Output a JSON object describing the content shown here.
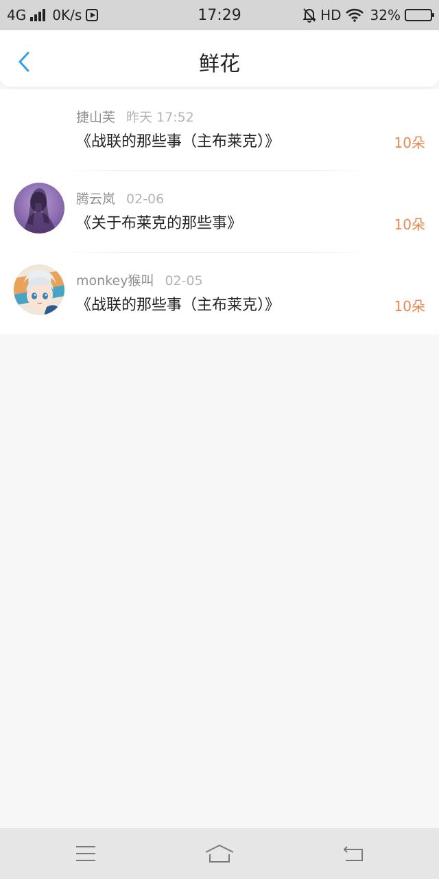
{
  "status_bar": {
    "network": "4G",
    "speed": "0K/s",
    "time": "17:29",
    "hd": "HD",
    "battery": "32%",
    "battery_level": 0.32,
    "icons": [
      "signal-icon",
      "media-play-icon",
      "mute-bell-icon",
      "wifi-icon",
      "battery-icon"
    ]
  },
  "header": {
    "title": "鲜花",
    "back_icon": "chevron-left-icon",
    "accent_color": "#2b9ff0"
  },
  "items": [
    {
      "user": "捷山芙",
      "date": "昨天 17:52",
      "title": "《战联的那些事（主布莱克）》",
      "count": "10朵",
      "avatar": "none"
    },
    {
      "user": "腾云岚",
      "date": "02-06",
      "title": "《关于布莱克的那些事》",
      "count": "10朵",
      "avatar": "purple-portrait"
    },
    {
      "user": "monkey猴叫",
      "date": "02-05",
      "title": "《战联的那些事（主布莱克）》",
      "count": "10朵",
      "avatar": "anime-character"
    }
  ],
  "colors": {
    "count": "#e9844a",
    "name": "#8f8f8f",
    "date": "#b4b4b4",
    "background": "#f8f7f8"
  },
  "nav": {
    "icons": [
      "menu-icon",
      "home-icon",
      "back-icon"
    ]
  }
}
